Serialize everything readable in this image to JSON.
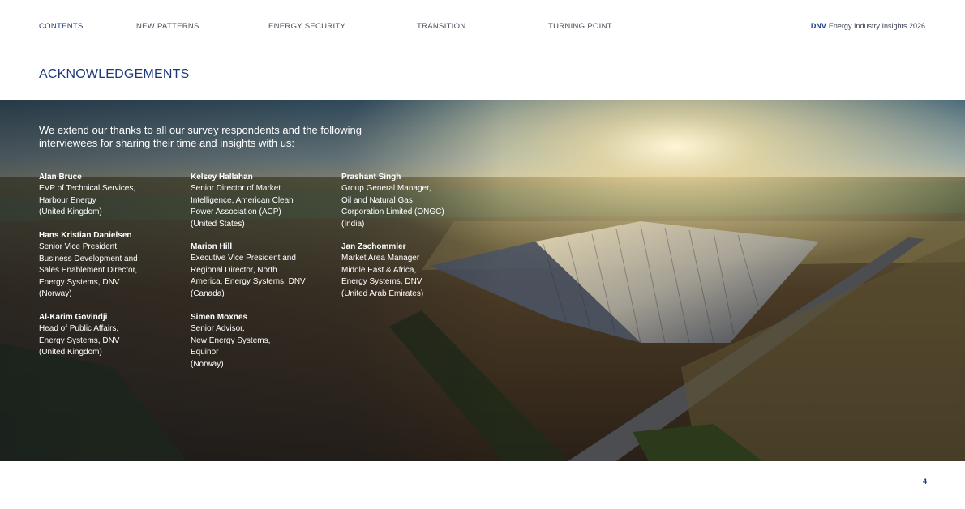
{
  "nav": {
    "items": [
      {
        "label": "CONTENTS",
        "active": true
      },
      {
        "label": "NEW PATTERNS",
        "active": false
      },
      {
        "label": "ENERGY SECURITY",
        "active": false
      },
      {
        "label": "TRANSITION",
        "active": false
      },
      {
        "label": "TURNING POINT",
        "active": false
      }
    ],
    "brand_logo": "DNV",
    "brand_text": "Energy Industry Insights 2026"
  },
  "heading": "ACKNOWLEDGEMENTS",
  "intro": "We extend our thanks to all our survey respondents and the following interviewees for sharing their time and insights with us:",
  "people": [
    {
      "name": "Alan Bruce",
      "role": "EVP of Technical Services,\nHarbour Energy\n(United Kingdom)"
    },
    {
      "name": "Hans Kristian Danielsen",
      "role": "Senior Vice President,\nBusiness Development and\nSales Enablement Director,\nEnergy Systems, DNV\n(Norway)"
    },
    {
      "name": "Al-Karim Govindji",
      "role": "Head of Public Affairs,\nEnergy Systems, DNV\n(United Kingdom)"
    },
    {
      "name": "Kelsey Hallahan",
      "role": "Senior Director of Market\nIntelligence, American Clean\nPower Association (ACP)\n(United States)"
    },
    {
      "name": "Marion Hill",
      "role": "Executive Vice President and\nRegional Director, North\nAmerica, Energy Systems, DNV\n(Canada)"
    },
    {
      "name": "Simen Moxnes",
      "role": "Senior Advisor,\nNew Energy Systems,\nEquinor\n(Norway)"
    },
    {
      "name": "Prashant Singh",
      "role": "Group General Manager,\nOil and Natural Gas\nCorporation Limited (ONGC)\n(India)"
    },
    {
      "name": "Jan Zschommler",
      "role": "Market Area Manager\nMiddle East & Africa,\nEnergy Systems, DNV\n(United Arab Emirates)"
    }
  ],
  "page_number": "4",
  "colors": {
    "accent": "#1c3a7a",
    "brand": "#1b3a8c"
  }
}
